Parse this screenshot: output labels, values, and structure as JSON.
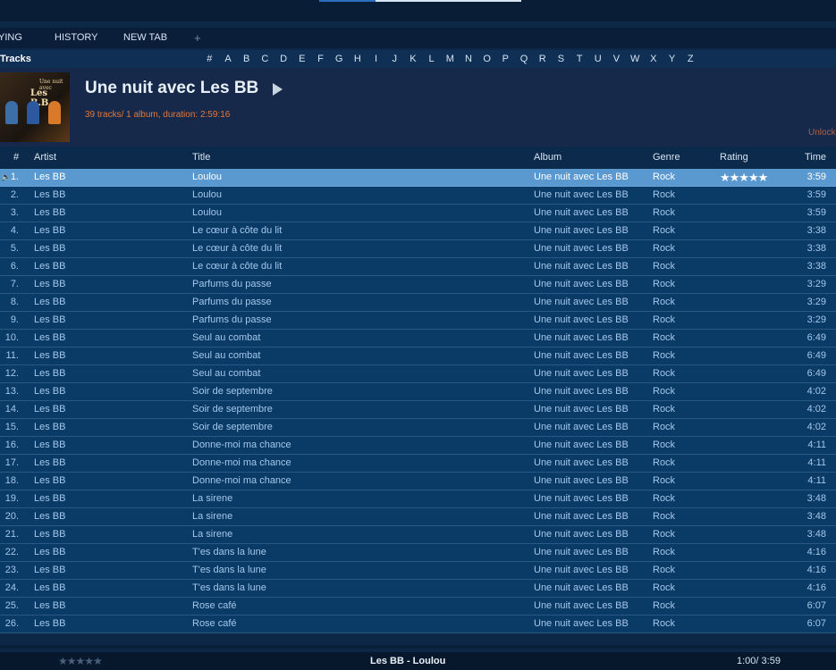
{
  "window": {
    "playback_progress": 0.28
  },
  "tabs": [
    {
      "label": "YING"
    },
    {
      "label": "HISTORY"
    },
    {
      "label": "NEW TAB"
    },
    {
      "label": "+"
    }
  ],
  "section_title": "Tracks",
  "alphabet": [
    "#",
    "A",
    "B",
    "C",
    "D",
    "E",
    "F",
    "G",
    "H",
    "I",
    "J",
    "K",
    "L",
    "M",
    "N",
    "O",
    "P",
    "Q",
    "R",
    "S",
    "T",
    "U",
    "V",
    "W",
    "X",
    "Y",
    "Z"
  ],
  "album": {
    "title": "Une nuit avec Les BB",
    "info": "39 tracks/ 1 album, duration: 2:59:16",
    "unlock_label": "Unlock",
    "cover_text_line1": "Une nuit avec",
    "cover_text_line2": "Les B.B."
  },
  "columns": {
    "num": "#",
    "artist": "Artist",
    "title": "Title",
    "album": "Album",
    "genre": "Genre",
    "rating": "Rating",
    "time": "Time"
  },
  "tracks": [
    {
      "num": "1.",
      "artist": "Les BB",
      "title": "Loulou",
      "album": "Une nuit avec Les BB",
      "genre": "Rock",
      "rating": "★★★★★",
      "time": "3:59",
      "playing": true
    },
    {
      "num": "2.",
      "artist": "Les BB",
      "title": "Loulou",
      "album": "Une nuit avec Les BB",
      "genre": "Rock",
      "rating": "",
      "time": "3:59"
    },
    {
      "num": "3.",
      "artist": "Les BB",
      "title": "Loulou",
      "album": "Une nuit avec Les BB",
      "genre": "Rock",
      "rating": "",
      "time": "3:59"
    },
    {
      "num": "4.",
      "artist": "Les BB",
      "title": "Le cœur à côte du lit",
      "album": "Une nuit avec Les BB",
      "genre": "Rock",
      "rating": "",
      "time": "3:38"
    },
    {
      "num": "5.",
      "artist": "Les BB",
      "title": "Le cœur à côte du lit",
      "album": "Une nuit avec Les BB",
      "genre": "Rock",
      "rating": "",
      "time": "3:38"
    },
    {
      "num": "6.",
      "artist": "Les BB",
      "title": "Le cœur à côte du lit",
      "album": "Une nuit avec Les BB",
      "genre": "Rock",
      "rating": "",
      "time": "3:38"
    },
    {
      "num": "7.",
      "artist": "Les BB",
      "title": "Parfums du passe",
      "album": "Une nuit avec Les BB",
      "genre": "Rock",
      "rating": "",
      "time": "3:29"
    },
    {
      "num": "8.",
      "artist": "Les BB",
      "title": "Parfums du passe",
      "album": "Une nuit avec Les BB",
      "genre": "Rock",
      "rating": "",
      "time": "3:29"
    },
    {
      "num": "9.",
      "artist": "Les BB",
      "title": "Parfums du passe",
      "album": "Une nuit avec Les BB",
      "genre": "Rock",
      "rating": "",
      "time": "3:29"
    },
    {
      "num": "10.",
      "artist": "Les BB",
      "title": "Seul au combat",
      "album": "Une nuit avec Les BB",
      "genre": "Rock",
      "rating": "",
      "time": "6:49"
    },
    {
      "num": "11.",
      "artist": "Les BB",
      "title": "Seul au combat",
      "album": "Une nuit avec Les BB",
      "genre": "Rock",
      "rating": "",
      "time": "6:49"
    },
    {
      "num": "12.",
      "artist": "Les BB",
      "title": "Seul au combat",
      "album": "Une nuit avec Les BB",
      "genre": "Rock",
      "rating": "",
      "time": "6:49"
    },
    {
      "num": "13.",
      "artist": "Les BB",
      "title": "Soir de septembre",
      "album": "Une nuit avec Les BB",
      "genre": "Rock",
      "rating": "",
      "time": "4:02"
    },
    {
      "num": "14.",
      "artist": "Les BB",
      "title": "Soir de septembre",
      "album": "Une nuit avec Les BB",
      "genre": "Rock",
      "rating": "",
      "time": "4:02"
    },
    {
      "num": "15.",
      "artist": "Les BB",
      "title": "Soir de septembre",
      "album": "Une nuit avec Les BB",
      "genre": "Rock",
      "rating": "",
      "time": "4:02"
    },
    {
      "num": "16.",
      "artist": "Les BB",
      "title": "Donne-moi ma chance",
      "album": "Une nuit avec Les BB",
      "genre": "Rock",
      "rating": "",
      "time": "4:11"
    },
    {
      "num": "17.",
      "artist": "Les BB",
      "title": "Donne-moi ma chance",
      "album": "Une nuit avec Les BB",
      "genre": "Rock",
      "rating": "",
      "time": "4:11"
    },
    {
      "num": "18.",
      "artist": "Les BB",
      "title": "Donne-moi ma chance",
      "album": "Une nuit avec Les BB",
      "genre": "Rock",
      "rating": "",
      "time": "4:11"
    },
    {
      "num": "19.",
      "artist": "Les BB",
      "title": "La sirene",
      "album": "Une nuit avec Les BB",
      "genre": "Rock",
      "rating": "",
      "time": "3:48"
    },
    {
      "num": "20.",
      "artist": "Les BB",
      "title": "La sirene",
      "album": "Une nuit avec Les BB",
      "genre": "Rock",
      "rating": "",
      "time": "3:48"
    },
    {
      "num": "21.",
      "artist": "Les BB",
      "title": "La sirene",
      "album": "Une nuit avec Les BB",
      "genre": "Rock",
      "rating": "",
      "time": "3:48"
    },
    {
      "num": "22.",
      "artist": "Les BB",
      "title": "T'es dans la lune",
      "album": "Une nuit avec Les BB",
      "genre": "Rock",
      "rating": "",
      "time": "4:16"
    },
    {
      "num": "23.",
      "artist": "Les BB",
      "title": "T'es dans la lune",
      "album": "Une nuit avec Les BB",
      "genre": "Rock",
      "rating": "",
      "time": "4:16"
    },
    {
      "num": "24.",
      "artist": "Les BB",
      "title": "T'es dans la lune",
      "album": "Une nuit avec Les BB",
      "genre": "Rock",
      "rating": "",
      "time": "4:16"
    },
    {
      "num": "25.",
      "artist": "Les BB",
      "title": "Rose café",
      "album": "Une nuit avec Les BB",
      "genre": "Rock",
      "rating": "",
      "time": "6:07"
    },
    {
      "num": "26.",
      "artist": "Les BB",
      "title": "Rose café",
      "album": "Une nuit avec Les BB",
      "genre": "Rock",
      "rating": "",
      "time": "6:07"
    }
  ],
  "footer": {
    "rating": "★★★★★",
    "now_playing": "Les BB - Loulou",
    "time": "1:00/ 3:59"
  },
  "colors": {
    "background": "#0d2847",
    "row": "#0a3a66",
    "row_selected": "#5a98d0",
    "accent_orange": "#e0783c"
  },
  "icons": {
    "play": "play-icon",
    "speaker": "speaker-icon"
  }
}
